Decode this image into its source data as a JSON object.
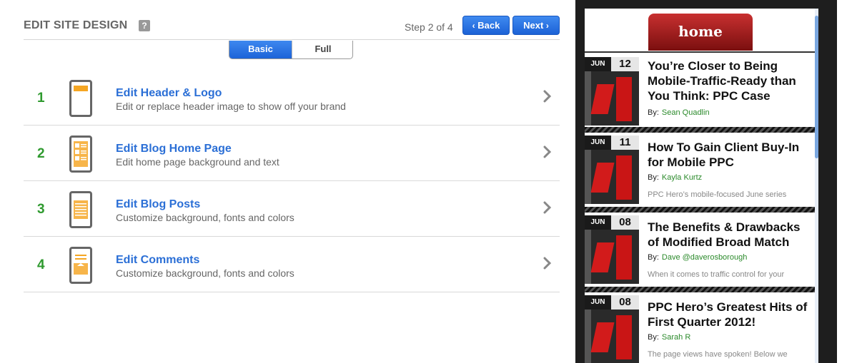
{
  "editor": {
    "title": "EDIT SITE DESIGN",
    "help_icon": "?",
    "step_text": "Step 2 of 4",
    "back_label": "Back",
    "next_label": "Next",
    "back_icon": "chevron-left-icon",
    "next_icon": "chevron-right-icon",
    "toggle": {
      "basic_label": "Basic",
      "full_label": "Full",
      "selected": "Basic"
    },
    "accent_color": "#2b6fd6",
    "number_color": "#2f9a2f",
    "items": [
      {
        "number": "1",
        "title": "Edit Header & Logo",
        "description": "Edit or replace header image to show off your brand",
        "icon": "phone-header-icon"
      },
      {
        "number": "2",
        "title": "Edit Blog Home Page",
        "description": "Edit home page background and text",
        "icon": "phone-home-page-icon"
      },
      {
        "number": "3",
        "title": "Edit Blog Posts",
        "description": "Customize background, fonts and colors",
        "icon": "phone-posts-icon"
      },
      {
        "number": "4",
        "title": "Edit Comments",
        "description": "Customize background, fonts and colors",
        "icon": "phone-comments-icon"
      }
    ]
  },
  "preview": {
    "home_tab": "home",
    "posts": [
      {
        "month": "JUN",
        "day": "12",
        "title": "You’re Closer to Being Mobile-Traffic-Ready than You Think: PPC Case",
        "by_label": "By:",
        "author": "Sean Quadlin",
        "excerpt": ""
      },
      {
        "month": "JUN",
        "day": "11",
        "title": "How To Gain Client Buy-In for Mobile PPC",
        "by_label": "By:",
        "author": "Kayla Kurtz",
        "excerpt": "PPC Hero’s mobile-focused June series"
      },
      {
        "month": "JUN",
        "day": "08",
        "title": "The Benefits & Drawbacks of Modified Broad Match",
        "by_label": "By:",
        "author": "Dave @daverosborough",
        "excerpt": "When it comes to traffic control for your"
      },
      {
        "month": "JUN",
        "day": "08",
        "title": "PPC Hero’s Greatest Hits of First Quarter 2012!",
        "by_label": "By:",
        "author": "Sarah R",
        "excerpt": "The page views have spoken! Below we"
      }
    ]
  }
}
